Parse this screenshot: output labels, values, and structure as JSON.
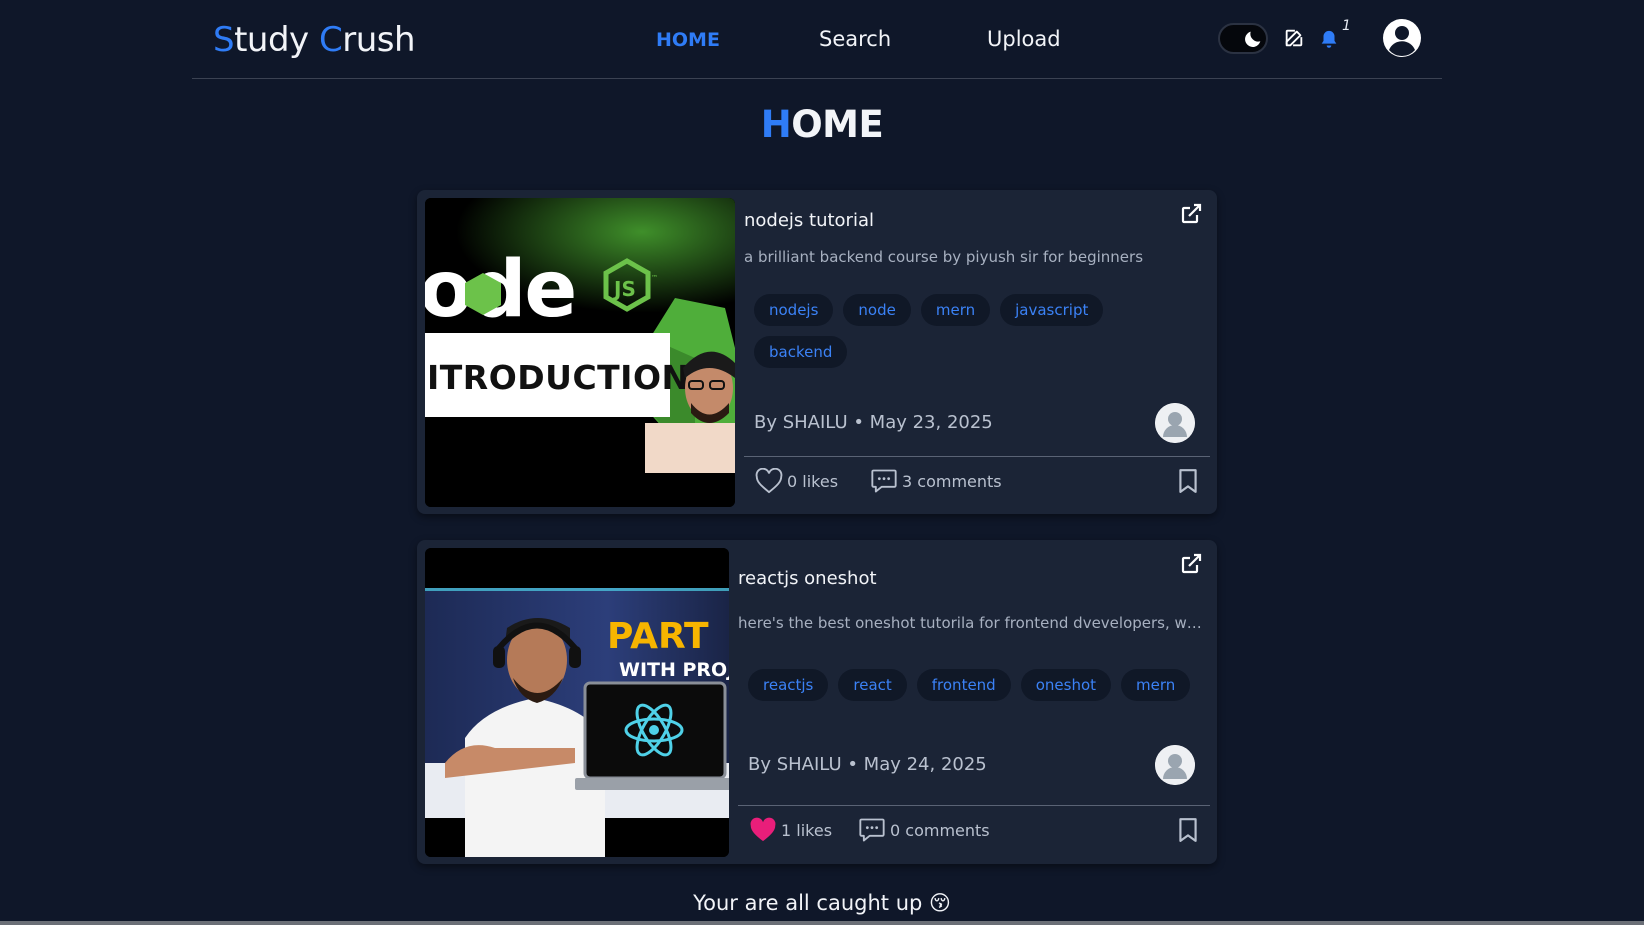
{
  "app": {
    "logo_first_initial": "S",
    "logo_first_rest": "tudy ",
    "logo_second_initial": "C",
    "logo_second_rest": "rush"
  },
  "nav": {
    "home": "HOME",
    "search": "Search",
    "upload": "Upload",
    "notification_count": "1"
  },
  "page": {
    "title_initial": "H",
    "title_rest": "OME"
  },
  "posts": [
    {
      "title": "nodejs tutorial",
      "description": "a brilliant backend course by piyush sir for beginners",
      "tags": [
        "nodejs",
        "node",
        "mern",
        "javascript",
        "backend"
      ],
      "author_line": "By SHAILU • May 23, 2025",
      "likes": "0 likes",
      "comments": "3 comments",
      "liked": false,
      "thumbnail": {
        "wordmark": "ode",
        "badge": "JS",
        "tm": "™",
        "banner": "ITRODUCTION"
      }
    },
    {
      "title": "reactjs oneshot",
      "description": "here's the best oneshot tutorila for frontend dvevelopers, who ...",
      "tags": [
        "reactjs",
        "react",
        "frontend",
        "oneshot",
        "mern"
      ],
      "author_line": "By SHAILU • May 24, 2025",
      "likes": "1 likes",
      "comments": "0 comments",
      "liked": true,
      "thumbnail": {
        "headline": "PART",
        "subline": "WITH PROJEC"
      }
    }
  ],
  "footer": {
    "message": "Your are all caught up 😚"
  },
  "colors": {
    "background": "#0f1729",
    "card": "#1b2436",
    "accent": "#2f7cf6",
    "like_active": "#e91e7a"
  }
}
